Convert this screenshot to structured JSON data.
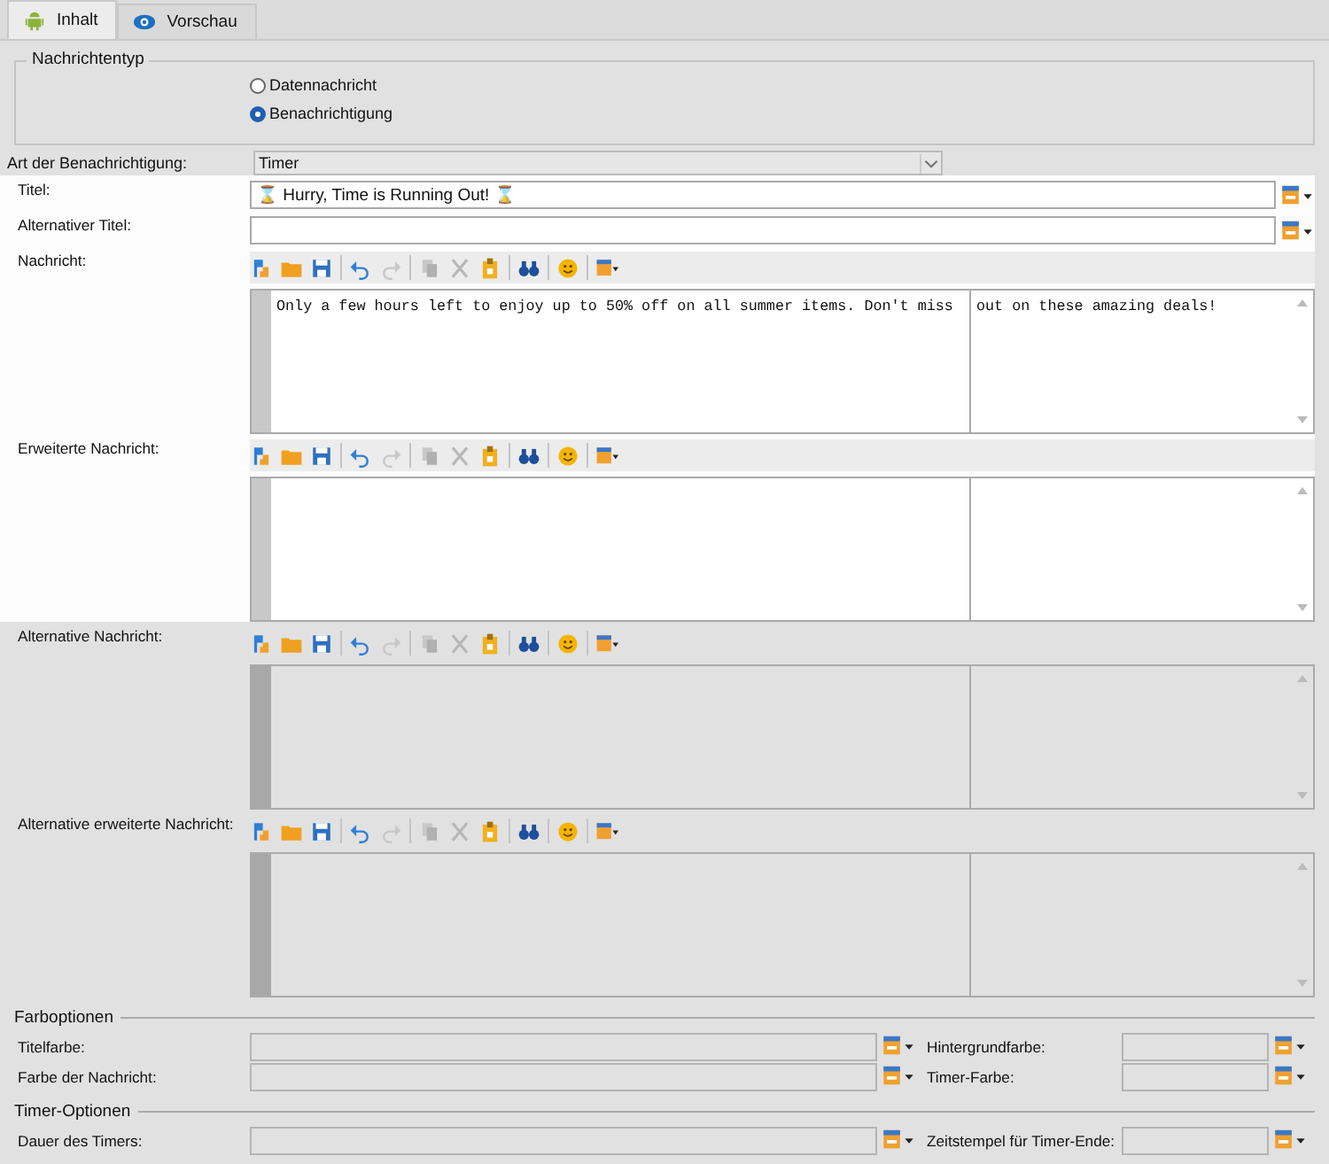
{
  "tabs": [
    {
      "label": "Inhalt",
      "selected": true
    },
    {
      "label": "Vorschau",
      "selected": false
    }
  ],
  "message_type": {
    "legend": "Nachrichtentyp",
    "options": [
      {
        "label": "Datennachricht",
        "selected": false
      },
      {
        "label": "Benachrichtigung",
        "selected": true
      }
    ]
  },
  "notification_kind": {
    "label": "Art der Benachrichtigung:",
    "value": "Timer"
  },
  "fields": [
    {
      "kind": "line",
      "label": "Titel:",
      "value": "⌛ Hurry, Time is Running Out! ⌛",
      "disabled": false
    },
    {
      "kind": "line",
      "label": "Alternativer Titel:",
      "disabled": false
    },
    {
      "kind": "editor",
      "label": "Nachricht:",
      "panes": [
        "Only a few hours left to enjoy up to 50% off on all summer items. Don't miss",
        "out on these amazing deals!"
      ],
      "disabled": false
    },
    {
      "kind": "editor",
      "label": "Erweiterte Nachricht:",
      "disabled": false
    },
    {
      "kind": "editor",
      "label": "Alternative Nachricht:",
      "disabled": true
    },
    {
      "kind": "editor",
      "label": "Alternative erweiterte Nachricht:",
      "disabled": true
    }
  ],
  "sections": [
    {
      "title": "Farboptionen",
      "rows": [
        [
          {
            "label": "Titelfarbe:",
            "disabled": true
          },
          {
            "label": "Hintergrundfarbe:",
            "disabled": true
          }
        ],
        [
          {
            "label": "Farbe der Nachricht:",
            "disabled": true
          },
          {
            "label": "Timer-Farbe:",
            "disabled": true
          }
        ]
      ]
    },
    {
      "title": "Timer-Optionen",
      "rows": [
        [
          {
            "label": "Dauer des Timers:",
            "disabled": true
          },
          {
            "label": "Zeitstempel für Timer-Ende:",
            "disabled": true
          }
        ]
      ]
    }
  ]
}
